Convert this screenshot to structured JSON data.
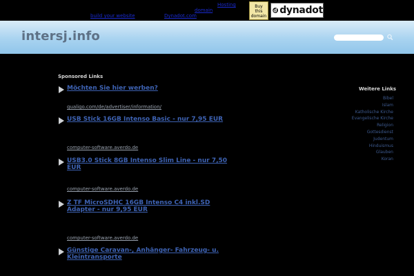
{
  "topbar": {
    "link_1": "Hosting",
    "link_2": "domain",
    "link_3": "build your website",
    "link_4": "Dynadot.com",
    "buy_line1": "Buy",
    "buy_line2": "this",
    "buy_line3": "domain",
    "brand": "dynadot"
  },
  "header": {
    "title": "intersj.info",
    "search_placeholder": ""
  },
  "sponsored": {
    "title": "Sponsored Links",
    "ads": [
      {
        "title": "Möchten Sie hier werben?",
        "url": "qualigo.com/de/advertiser/information/"
      },
      {
        "title": "USB Stick 16GB Intenso Basic - nur 7,95 EUR",
        "url": "computer-software.averdo.de"
      },
      {
        "title": "USB3.0 Stick 8GB Intenso Slim Line - nur 7,50 EUR",
        "url": "computer-software.averdo.de"
      },
      {
        "title": "Z TF MicroSDHC 16GB Intenso C4 inkl.SD Adapter - nur 9,95 EUR",
        "url": "computer-software.averdo.de"
      },
      {
        "title": "Günstige Caravan-, Anhänger- Fahrzeug- u. Kleintransporte",
        "url": ""
      }
    ]
  },
  "sidebar": {
    "title": "Weitere Links",
    "links": [
      "Bibel",
      "Islam",
      "Katholische Kirche",
      "Evangelische Kirche",
      "Religion",
      "Gottesdienst",
      "Judentum",
      "Hinduismus",
      "Glauben",
      "Koran"
    ]
  },
  "colors": {
    "background": "#000000",
    "header_gradient_top": "#d9ecf8",
    "header_gradient_bottom": "#90c5ea",
    "ad_link": "#3e63b4",
    "side_link": "#3e5b91"
  }
}
